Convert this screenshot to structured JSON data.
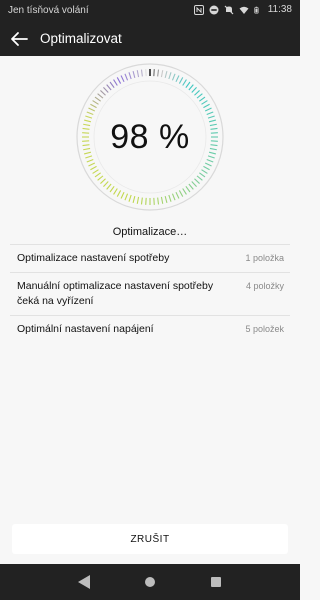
{
  "status_bar": {
    "carrier_text": "Jen tísňová volání",
    "time": "11:38",
    "icons": [
      "nfc-icon",
      "dnd-icon",
      "mute-icon",
      "wifi-icon",
      "battery-icon"
    ]
  },
  "app_bar": {
    "back_icon": "arrow-left-icon",
    "title": "Optimalizovat"
  },
  "gauge": {
    "value_text": "98 %",
    "progress_fraction": 0.98
  },
  "status_text": "Optimalizace…",
  "items": [
    {
      "name": "Optimalizace nastavení spotřeby",
      "count": "1 položka"
    },
    {
      "name": "Manuální optimalizace nastavení spotřeby čeká na vyřízení",
      "count": "4 položky"
    },
    {
      "name": "Optimální nastavení napájení",
      "count": "5 položek"
    }
  ],
  "cancel_label": "ZRUŠIT",
  "nav_bar": {
    "icons": [
      "nav-back-icon",
      "nav-home-icon",
      "nav-recents-icon"
    ]
  },
  "colors": {
    "bar_background": "#222222",
    "content_background": "#f7f7f7",
    "gauge_gradient_start": "#c2d84b",
    "gauge_gradient_mid": "#3fc7c2",
    "gauge_gradient_end": "#8a6fd8"
  }
}
